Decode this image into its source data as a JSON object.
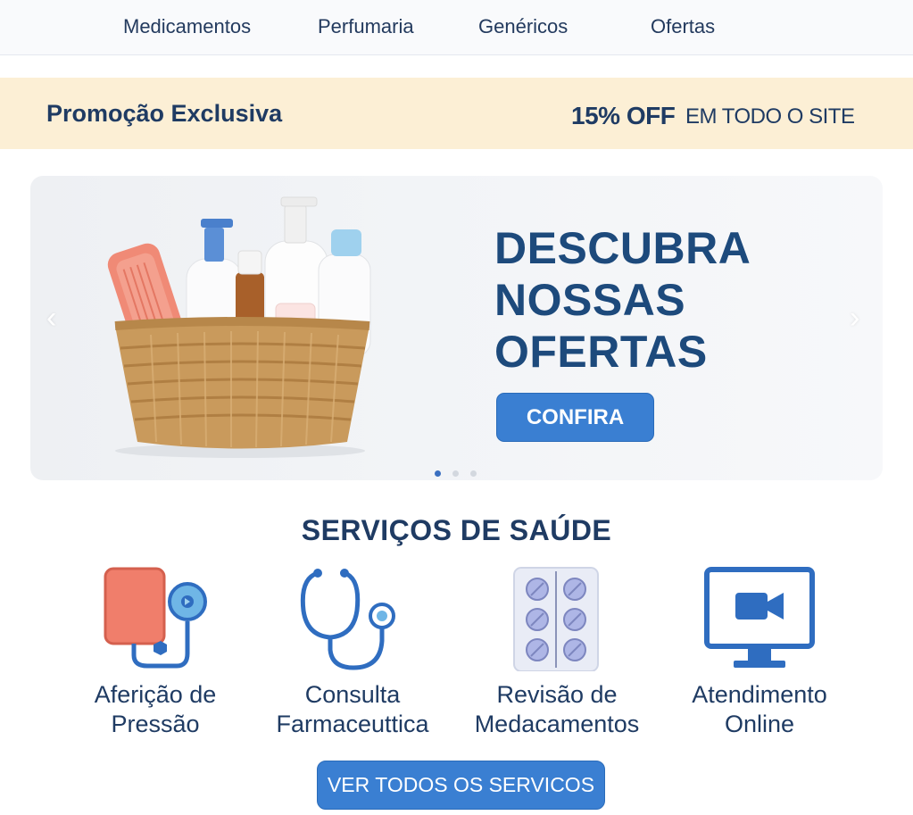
{
  "nav": {
    "items": [
      {
        "label": "Medicamentos"
      },
      {
        "label": "Perfumaria"
      },
      {
        "label": "Genéricos"
      },
      {
        "label": "Ofertas"
      }
    ]
  },
  "promo": {
    "title": "Promoção Exclusiva",
    "discount": "15% OFF",
    "scope": "EM TODO O SITE",
    "background": "#fcefd5"
  },
  "hero": {
    "title_lines": [
      "DESCUBRA",
      "NOSSAS",
      "OFERTAS"
    ],
    "cta_label": "CONFIRA",
    "prev_arrow": "‹",
    "next_arrow": "›",
    "slide_count": 3,
    "active_slide": 1,
    "image_icon": "basket-of-toiletries-image"
  },
  "services": {
    "title": "SERVIÇOS DE SAÚDE",
    "items": [
      {
        "label_lines": [
          "Aferição de",
          "Pressão"
        ],
        "icon": "blood-pressure-monitor-icon"
      },
      {
        "label_lines": [
          "Consulta",
          "Farmaceuttica"
        ],
        "icon": "stethoscope-icon"
      },
      {
        "label_lines": [
          "Revisão de",
          "Medacamentos"
        ],
        "icon": "pill-blister-icon"
      },
      {
        "label_lines": [
          "Atendimento",
          "Online"
        ],
        "icon": "video-monitor-icon"
      }
    ],
    "all_button_label": "VER TODOS OS SERVICOS"
  },
  "colors": {
    "accent": "#3a7fd2",
    "heading": "#1f3b63",
    "hero_title": "#1d4a7c"
  }
}
